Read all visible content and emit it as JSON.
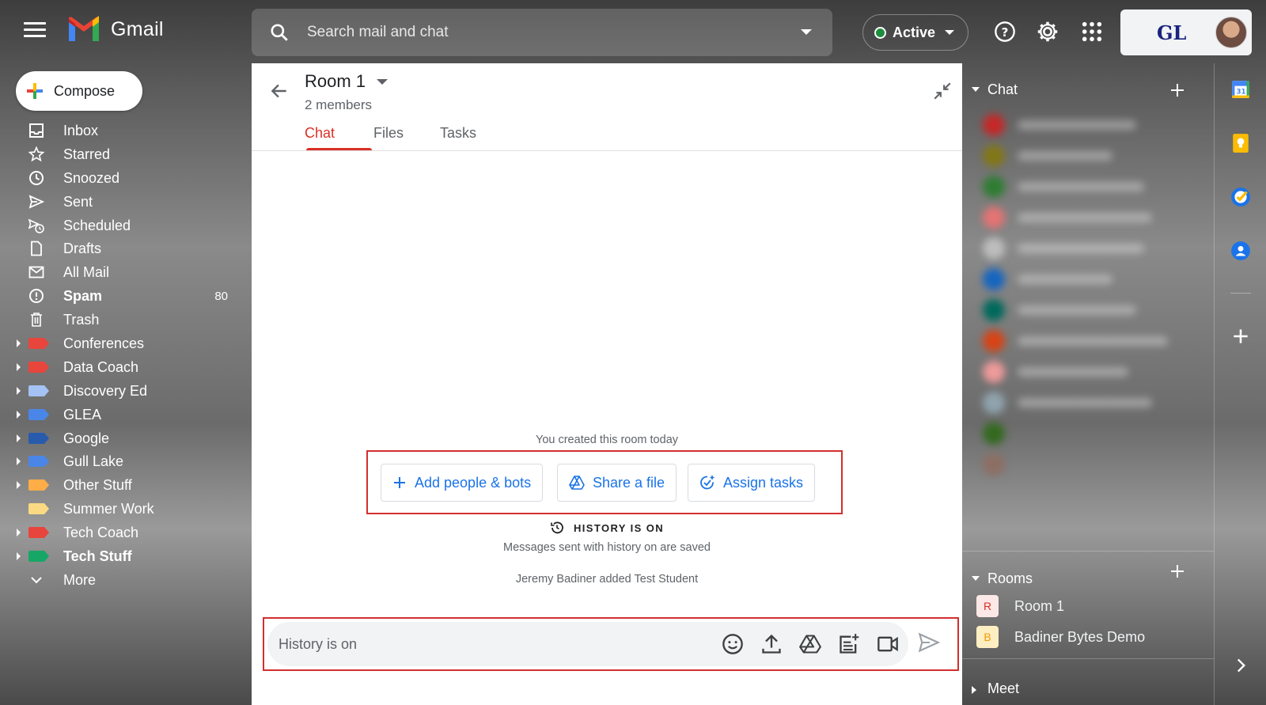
{
  "header": {
    "app_name": "Gmail",
    "search_placeholder": "Search mail and chat",
    "status_label": "Active",
    "org_logo_text": "GL"
  },
  "sidebar": {
    "compose_label": "Compose",
    "items": [
      {
        "label": "Inbox",
        "icon": "inbox-icon"
      },
      {
        "label": "Starred",
        "icon": "star-icon"
      },
      {
        "label": "Snoozed",
        "icon": "clock-icon"
      },
      {
        "label": "Sent",
        "icon": "send-icon"
      },
      {
        "label": "Scheduled",
        "icon": "scheduled-icon"
      },
      {
        "label": "Drafts",
        "icon": "draft-icon"
      },
      {
        "label": "All Mail",
        "icon": "mail-icon"
      },
      {
        "label": "Spam",
        "icon": "spam-icon",
        "count": "80"
      },
      {
        "label": "Trash",
        "icon": "trash-icon"
      }
    ],
    "labels": [
      {
        "label": "Conferences",
        "color": "#e8453c"
      },
      {
        "label": "Data Coach",
        "color": "#e8453c"
      },
      {
        "label": "Discovery Ed",
        "color": "#a4c2f4"
      },
      {
        "label": "GLEA",
        "color": "#4a86e8"
      },
      {
        "label": "Google",
        "color": "#285bac"
      },
      {
        "label": "Gull Lake",
        "color": "#4a86e8"
      },
      {
        "label": "Other Stuff",
        "color": "#ffad47"
      },
      {
        "label": "Summer Work",
        "color": "#fcda83"
      },
      {
        "label": "Tech Coach",
        "color": "#e8453c"
      },
      {
        "label": "Tech Stuff",
        "color": "#16a766"
      }
    ],
    "more_label": "More"
  },
  "room": {
    "title": "Room 1",
    "members": "2 members",
    "tabs": [
      "Chat",
      "Files",
      "Tasks"
    ],
    "created_note": "You created this room today",
    "actions": [
      "Add people & bots",
      "Share a file",
      "Assign tasks"
    ],
    "history_label": "HISTORY IS ON",
    "history_sub": "Messages sent with history on are saved",
    "added_note": "Jeremy Badiner added Test Student",
    "message_placeholder": "History is on"
  },
  "right_panel": {
    "chat_title": "Chat",
    "rooms_title": "Rooms",
    "rooms": [
      {
        "initial": "R",
        "name": "Room 1",
        "bg": "#fce8e6",
        "fg": "#d93025"
      },
      {
        "initial": "B",
        "name": "Badiner Bytes Demo",
        "bg": "#feefc3",
        "fg": "#f29900"
      }
    ],
    "meet_title": "Meet"
  },
  "colors": {
    "accent_red": "#d93025",
    "link_blue": "#1a73e8",
    "highlight_box": "#d32f2f",
    "active_green": "#1e8e3e"
  }
}
